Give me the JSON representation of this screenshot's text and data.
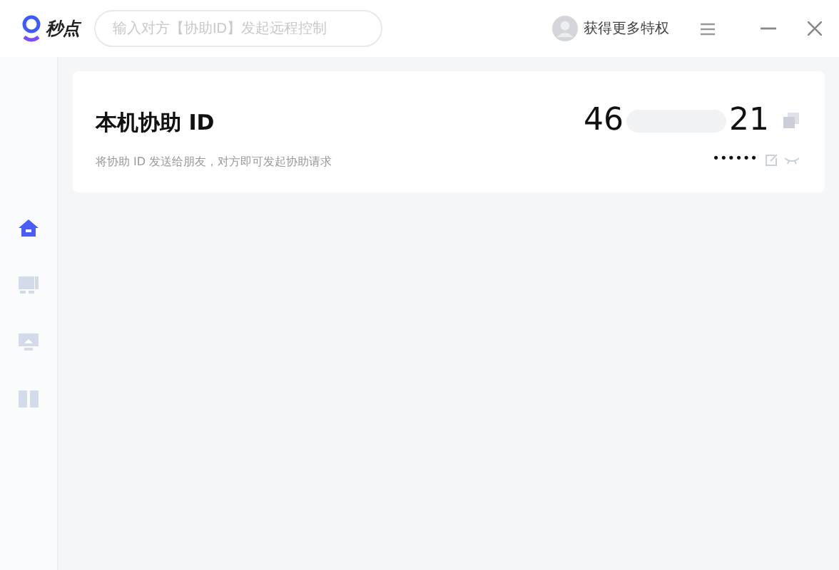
{
  "app": {
    "name": "秒点"
  },
  "search": {
    "placeholder": "输入对方【协助ID】发起远程控制"
  },
  "account": {
    "label": "获得更多特权"
  },
  "sidebar": {
    "items": [
      {
        "kind": "home",
        "selected": true
      },
      {
        "kind": "devices",
        "selected": false
      },
      {
        "kind": "screen",
        "selected": false
      },
      {
        "kind": "book",
        "selected": false
      }
    ]
  },
  "card": {
    "title": "本机协助 ID",
    "hint": "将协助 ID 发送给朋友，对方即可发起协助请求",
    "id_start": "46",
    "id_end": "21",
    "password": "••••••"
  }
}
